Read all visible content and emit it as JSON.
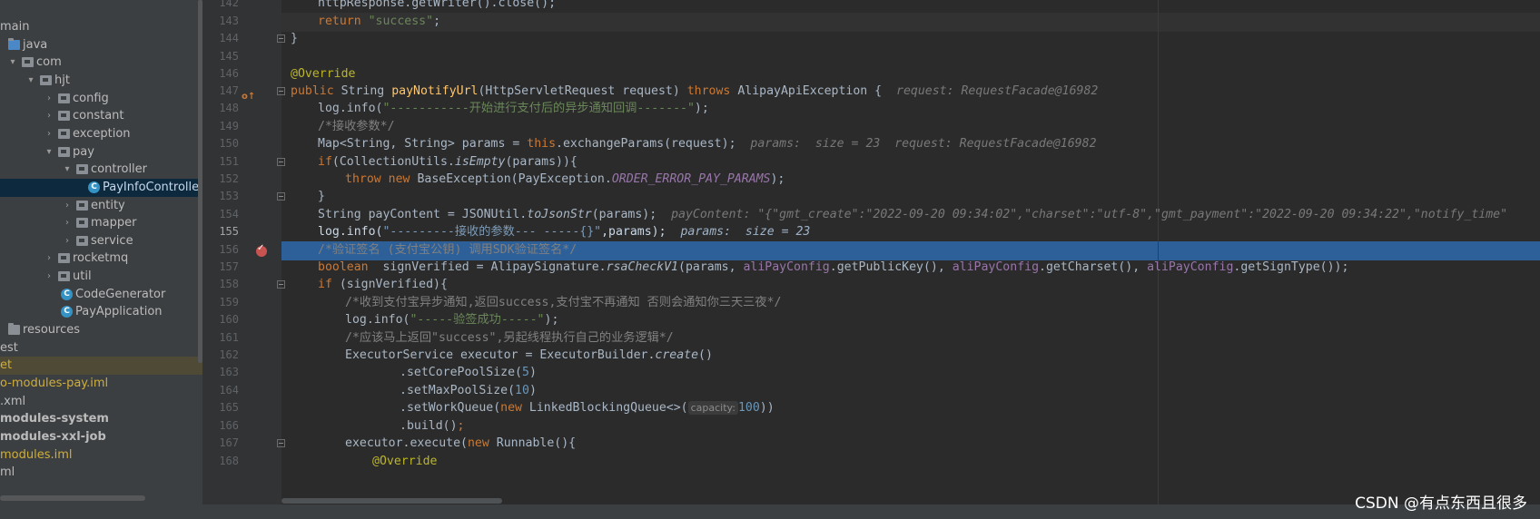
{
  "project_tree": {
    "items": [
      {
        "label": "main",
        "type": "text",
        "indent": -30
      },
      {
        "label": "java",
        "type": "folder-blue",
        "indent": -5
      },
      {
        "label": "com",
        "type": "pkg",
        "indent": 10,
        "arrow": "▾"
      },
      {
        "label": "hjt",
        "type": "pkg",
        "indent": 30,
        "arrow": "▾"
      },
      {
        "label": "config",
        "type": "pkg",
        "indent": 50,
        "arrow": "›"
      },
      {
        "label": "constant",
        "type": "pkg",
        "indent": 50,
        "arrow": "›"
      },
      {
        "label": "exception",
        "type": "pkg",
        "indent": 50,
        "arrow": "›"
      },
      {
        "label": "pay",
        "type": "pkg",
        "indent": 50,
        "arrow": "▾"
      },
      {
        "label": "controller",
        "type": "pkg",
        "indent": 70,
        "arrow": "▾"
      },
      {
        "label": "PayInfoController",
        "type": "class",
        "indent": 95,
        "selected": true
      },
      {
        "label": "entity",
        "type": "pkg",
        "indent": 70,
        "arrow": "›"
      },
      {
        "label": "mapper",
        "type": "pkg",
        "indent": 70,
        "arrow": "›"
      },
      {
        "label": "service",
        "type": "pkg",
        "indent": 70,
        "arrow": "›"
      },
      {
        "label": "rocketmq",
        "type": "pkg",
        "indent": 50,
        "arrow": "›"
      },
      {
        "label": "util",
        "type": "pkg",
        "indent": 50,
        "arrow": "›"
      },
      {
        "label": "CodeGenerator",
        "type": "class",
        "indent": 65
      },
      {
        "label": "PayApplication",
        "type": "class",
        "indent": 65
      },
      {
        "label": "resources",
        "type": "folder",
        "indent": -5
      },
      {
        "label": "est",
        "type": "text",
        "indent": -20
      },
      {
        "label": "et",
        "type": "text-yellow",
        "indent": -20,
        "highlight": true
      },
      {
        "label": "o-modules-pay.iml",
        "type": "text-yellow",
        "indent": -20
      },
      {
        "label": ".xml",
        "type": "text",
        "indent": -20
      },
      {
        "label": "modules-system",
        "type": "text-bold",
        "indent": -20
      },
      {
        "label": "modules-xxl-job",
        "type": "text-bold",
        "indent": -20
      },
      {
        "label": "modules.iml",
        "type": "text-yellow",
        "indent": -20
      },
      {
        "label": "ml",
        "type": "text",
        "indent": -20
      }
    ]
  },
  "gutter": {
    "line_numbers": [
      "142",
      "143",
      "144",
      "145",
      "146",
      "147",
      "148",
      "149",
      "150",
      "151",
      "152",
      "153",
      "154",
      "155",
      "156",
      "157",
      "158",
      "159",
      "160",
      "161",
      "162",
      "163",
      "164",
      "165",
      "166",
      "167",
      "168"
    ],
    "current_line": "155",
    "override_marker": {
      "o": "o",
      "arrow": "↑"
    }
  },
  "code": {
    "l142": "httpResponse.getWriter().close();",
    "l143_kw": "return",
    "l143_str": "\"success\"",
    "l144": "}",
    "l146": "@Override",
    "l147_kw1": "public",
    "l147_t1": "String",
    "l147_fn": "payNotifyUrl",
    "l147_params": "(HttpServletRequest request)",
    "l147_kw2": "throws",
    "l147_t2": "AlipayApiException {",
    "l147_hint": "request: RequestFacade@16982",
    "l148_a": "log.info(",
    "l148_str": "\"-----------开始进行支付后的异步通知回调-------\"",
    "l148_b": ");",
    "l149": "/*接收参数*/",
    "l150_a": "Map<String, String> params = ",
    "l150_kw": "this",
    "l150_b": ".exchangeParams(request);",
    "l150_hint": "params:  size = 23  request: RequestFacade@16982",
    "l151_kw": "if",
    "l151_a": "(CollectionUtils.",
    "l151_it": "isEmpty",
    "l151_b": "(params)){",
    "l152_kw1": "throw",
    "l152_kw2": "new",
    "l152_a": "BaseException(PayException.",
    "l152_fld": "ORDER_ERROR_PAY_PARAMS",
    "l152_b": ");",
    "l153": "}",
    "l154_a": "String payContent = JSONUtil.",
    "l154_it": "toJsonStr",
    "l154_b": "(params);",
    "l154_hint": "payContent: \"{\"gmt_create\":\"2022-09-20 09:34:02\",\"charset\":\"utf-8\",\"gmt_payment\":\"2022-09-20 09:34:22\",\"notify_time\"",
    "l155_a": "log.info(",
    "l155_str": "\"---------接收的参数--- -----{}\"",
    "l155_b": ",params);",
    "l155_hint": "params:  size = 23",
    "l156": "/*验证签名 (支付宝公钥) 调用SDK验证签名*/",
    "l157_kw": "boolean",
    "l157_a": "  signVerified = AlipaySignature.",
    "l157_it": "rsaCheckV1",
    "l157_b": "(params, ",
    "l157_f1": "aliPayConfig",
    "l157_c": ".getPublicKey(), ",
    "l157_f2": "aliPayConfig",
    "l157_d": ".getCharset(), ",
    "l157_f3": "aliPayConfig",
    "l157_e": ".getSignType());",
    "l158_kw": "if",
    "l158_a": " (signVerified){",
    "l159": "/*收到支付宝异步通知,返回success,支付宝不再通知 否则会通知你三天三夜*/",
    "l160_a": "log.info(",
    "l160_str": "\"-----验签成功-----\"",
    "l160_b": ");",
    "l161": "/*应该马上返回\"success\",另起线程执行自己的业务逻辑*/",
    "l162_a": "ExecutorService executor = ExecutorBuilder.",
    "l162_it": "create",
    "l162_b": "()",
    "l163_a": ".setCorePoolSize(",
    "l163_num": "5",
    "l163_b": ")",
    "l164_a": ".setMaxPoolSize(",
    "l164_num": "10",
    "l164_b": ")",
    "l165_a": ".setWorkQueue(",
    "l165_kw": "new",
    "l165_b": " LinkedBlockingQueue<>(",
    "l165_cap": "capacity:",
    "l165_num": "100",
    "l165_c": "))",
    "l166_a": ".build()",
    "l166_b": ";",
    "l167_a": "executor.execute(",
    "l167_kw": "new",
    "l167_b": " Runnable(){",
    "l168": "@Override"
  },
  "watermark": "CSDN @有点东西且很多"
}
